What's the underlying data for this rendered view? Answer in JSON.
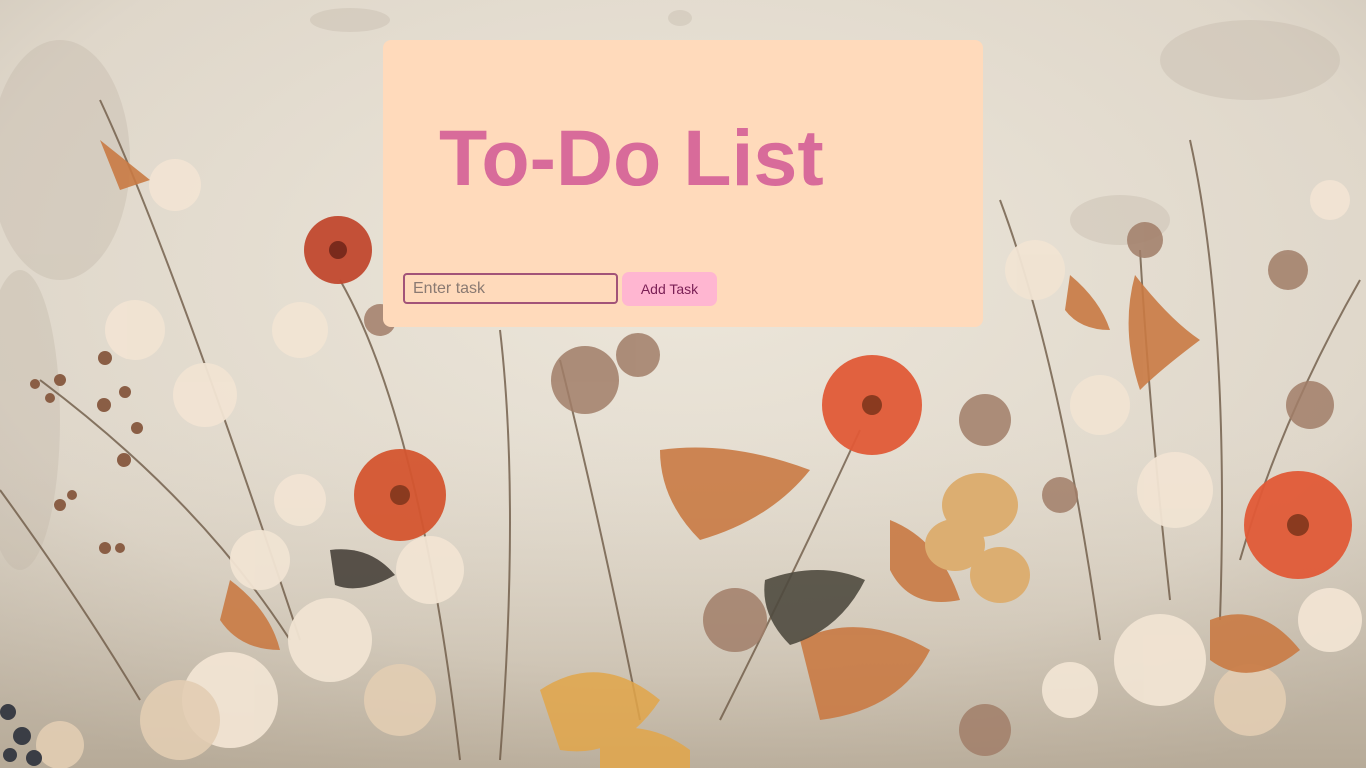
{
  "app": {
    "title": "To-Do List"
  },
  "form": {
    "task_input_placeholder": "Enter task",
    "task_input_value": "",
    "add_button_label": "Add Task"
  },
  "colors": {
    "card_background": "#ffdabb",
    "title": "#d86b9a",
    "input_border": "#a25378",
    "button_background": "#ffb6d1",
    "button_text": "#7a1f55"
  }
}
